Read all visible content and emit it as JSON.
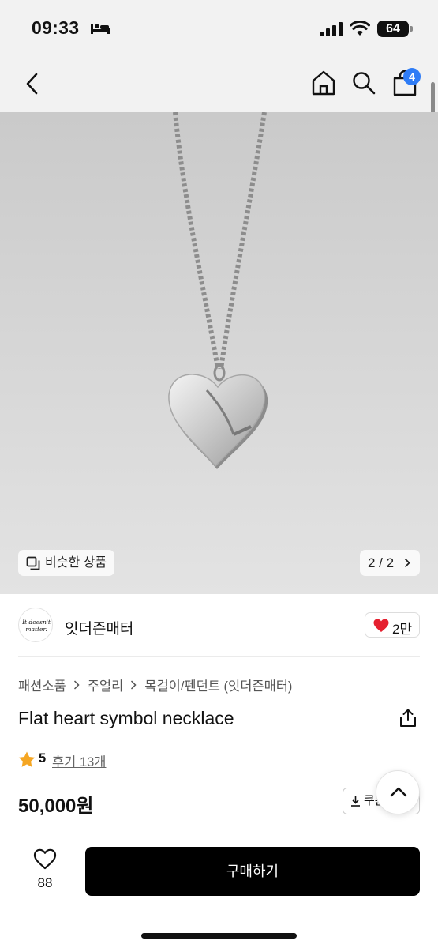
{
  "status_bar": {
    "time": "09:33",
    "battery": "64"
  },
  "nav": {
    "cart_badge": "4"
  },
  "image_overlay": {
    "similar_label": "비슷한 상품",
    "page_indicator": "2 / 2"
  },
  "brand": {
    "name": "잇더즌매터",
    "like_count": "2만",
    "logo_text_line1": "It doesn't",
    "logo_text_line2": "matter."
  },
  "breadcrumb": [
    "패션소품",
    "주얼리",
    "목걸이/펜던트 (잇더즌매터)"
  ],
  "product": {
    "title": "Flat heart symbol necklace",
    "rating": "5",
    "review_label": "후기 13개",
    "price": "50,000원",
    "coupon_label": "쿠폰"
  },
  "bottom_bar": {
    "wish_count": "88",
    "buy_label": "구매하기"
  },
  "colors": {
    "accent": "#2e7cf6",
    "heart": "#e5202f",
    "star": "#f5a623",
    "buy_bg": "#000000"
  },
  "icons": [
    "back-icon",
    "home-icon",
    "search-icon",
    "cart-icon",
    "similar-icon",
    "chevron-right-icon",
    "heart-icon",
    "share-icon",
    "star-icon",
    "download-icon",
    "chevron-up-icon"
  ]
}
